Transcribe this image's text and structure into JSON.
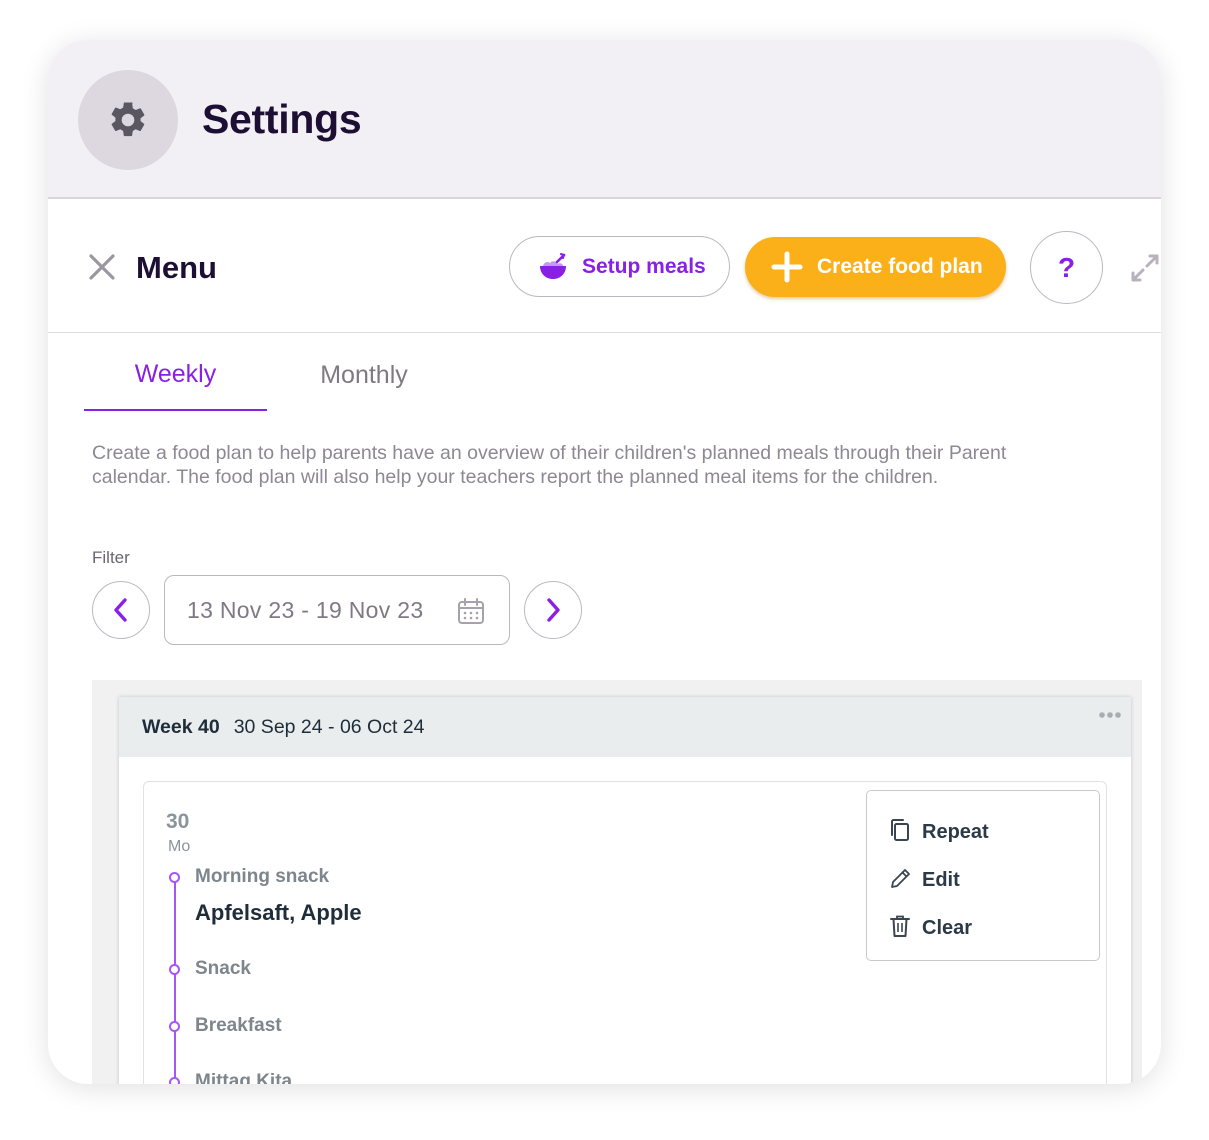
{
  "header": {
    "title": "Settings",
    "icon": "gear-icon"
  },
  "toolbar": {
    "title": "Menu",
    "setup_meals_label": "Setup meals",
    "create_plan_label": "Create food plan",
    "help_label": "?"
  },
  "tabs": [
    {
      "label": "Weekly",
      "active": true
    },
    {
      "label": "Monthly",
      "active": false
    }
  ],
  "description": "Create a food plan to help parents have an overview of their children's planned meals through their Parent calendar. The food plan will also help your teachers report the planned meal items for the children.",
  "filter": {
    "label": "Filter",
    "date_range": "13 Nov 23 - 19 Nov 23"
  },
  "week": {
    "label": "Week 40",
    "range": "30 Sep 24 - 06 Oct 24"
  },
  "day": {
    "number": "30",
    "weekday": "Mo",
    "meals": [
      {
        "label": "Morning snack",
        "items": "Apfelsaft, Apple"
      },
      {
        "label": "Snack"
      },
      {
        "label": "Breakfast"
      },
      {
        "label": "Mittag Kita"
      }
    ]
  },
  "context_menu": [
    {
      "label": "Repeat",
      "icon": "copy-icon"
    },
    {
      "label": "Edit",
      "icon": "pencil-icon"
    },
    {
      "label": "Clear",
      "icon": "trash-icon"
    }
  ],
  "colors": {
    "accent_purple": "#8a1fe6",
    "primary_orange": "#fbb01a",
    "title_dark": "#1d0f33",
    "header_bg": "#f2f0f5",
    "timeline_purple": "#a855f7"
  }
}
